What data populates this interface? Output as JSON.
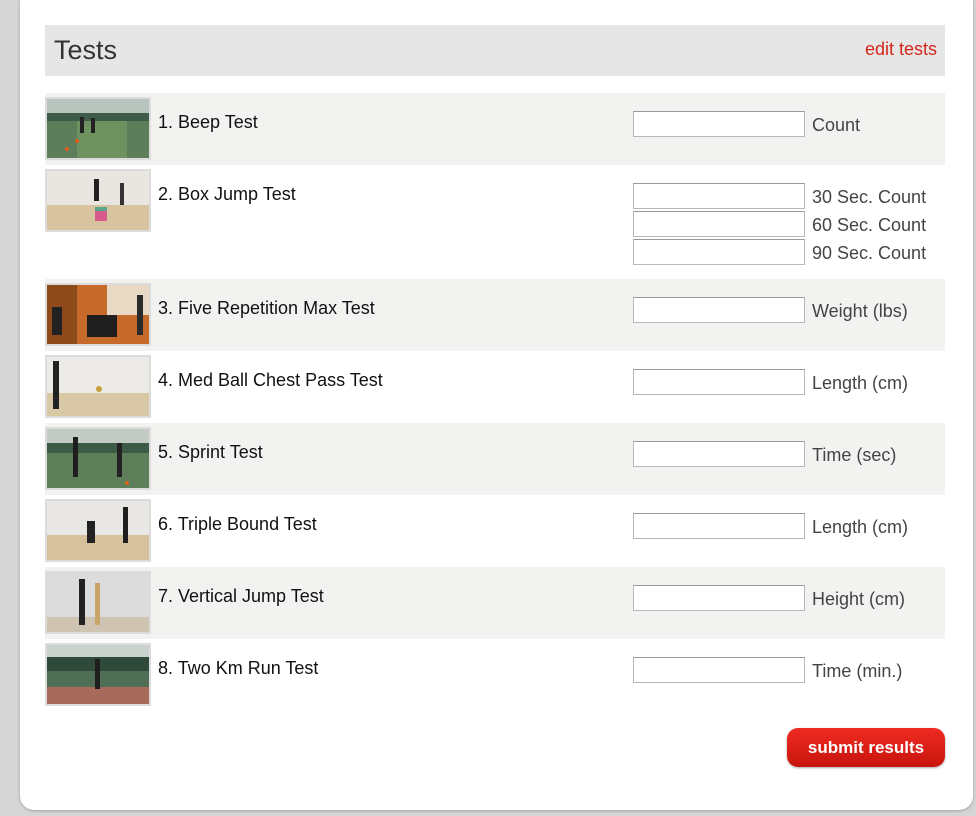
{
  "panel": {
    "title": "Tests",
    "edit_link": "edit tests",
    "submit_label": "submit results"
  },
  "tests": [
    {
      "name": "1. Beep Test",
      "fields": [
        {
          "unit": "Count",
          "value": ""
        }
      ]
    },
    {
      "name": "2. Box Jump Test",
      "fields": [
        {
          "unit": "30 Sec. Count",
          "value": ""
        },
        {
          "unit": "60 Sec. Count",
          "value": ""
        },
        {
          "unit": "90 Sec. Count",
          "value": ""
        }
      ]
    },
    {
      "name": "3. Five Repetition Max Test",
      "fields": [
        {
          "unit": "Weight (lbs)",
          "value": ""
        }
      ]
    },
    {
      "name": "4. Med Ball Chest Pass Test",
      "fields": [
        {
          "unit": "Length (cm)",
          "value": ""
        }
      ]
    },
    {
      "name": "5. Sprint Test",
      "fields": [
        {
          "unit": "Time (sec)",
          "value": ""
        }
      ]
    },
    {
      "name": "6. Triple Bound Test",
      "fields": [
        {
          "unit": "Length (cm)",
          "value": ""
        }
      ]
    },
    {
      "name": "7. Vertical Jump Test",
      "fields": [
        {
          "unit": "Height (cm)",
          "value": ""
        }
      ]
    },
    {
      "name": "8. Two Km Run Test",
      "fields": [
        {
          "unit": "Time (min.)",
          "value": ""
        }
      ]
    }
  ],
  "colors": {
    "accent": "#d4261a",
    "header_bg": "#e6e6e6",
    "alt_row_bg": "#f2f2f0"
  }
}
